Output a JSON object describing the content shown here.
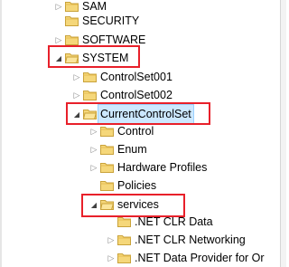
{
  "tree": {
    "items": [
      {
        "label": "SAM",
        "state": "collapsed"
      },
      {
        "label": "SECURITY",
        "state": "none"
      },
      {
        "label": "SOFTWARE",
        "state": "collapsed"
      },
      {
        "label": "SYSTEM",
        "state": "expanded"
      },
      {
        "label": "ControlSet001",
        "state": "collapsed"
      },
      {
        "label": "ControlSet002",
        "state": "collapsed"
      },
      {
        "label": "CurrentControlSet",
        "state": "expanded"
      },
      {
        "label": "Control",
        "state": "collapsed"
      },
      {
        "label": "Enum",
        "state": "collapsed"
      },
      {
        "label": "Hardware Profiles",
        "state": "collapsed"
      },
      {
        "label": "Policies",
        "state": "none"
      },
      {
        "label": "services",
        "state": "expanded"
      },
      {
        "label": ".NET CLR Data",
        "state": "none"
      },
      {
        "label": ".NET CLR Networking",
        "state": "collapsed"
      },
      {
        "label": ".NET Data Provider for Or",
        "state": "collapsed"
      }
    ]
  },
  "colors": {
    "highlight_border": "#e8202a",
    "selection_bg": "#cce8ff",
    "folder_fill": "#f5d77a",
    "folder_stroke": "#c9a23a"
  }
}
